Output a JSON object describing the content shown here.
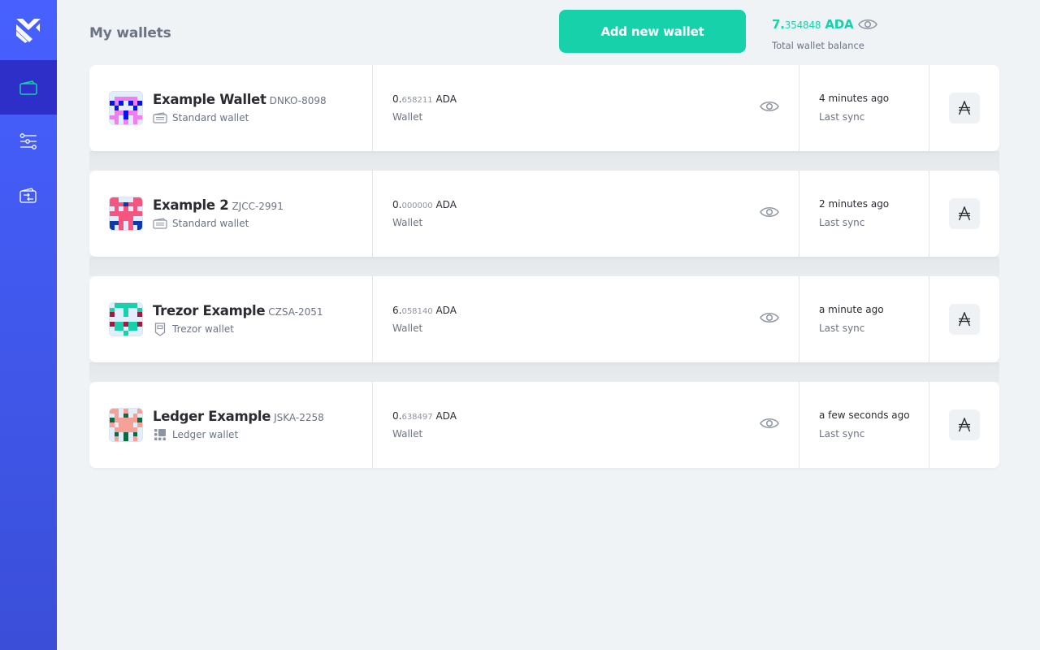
{
  "sidebar": {
    "items": [
      {
        "name": "wallets",
        "icon": "wallet-icon",
        "active": true
      },
      {
        "name": "settings",
        "icon": "sliders-icon",
        "active": false
      },
      {
        "name": "transfer",
        "icon": "transfer-icon",
        "active": false
      }
    ]
  },
  "header": {
    "title": "My wallets",
    "add_wallet_label": "Add new wallet",
    "total_balance": {
      "integer": "7.",
      "decimal": "354848",
      "currency": "ADA"
    },
    "total_balance_label": "Total wallet balance"
  },
  "colors": {
    "accent": "#17d1aa",
    "sidebar": "#4760ff",
    "sidebar_active": "#2e2fc8"
  },
  "wallets": [
    {
      "name": "Example Wallet",
      "plate": "DNKO-8098",
      "type": "Standard wallet",
      "type_icon": "standard-wallet-icon",
      "balance": {
        "integer": "0.",
        "decimal": "658211",
        "currency": "ADA"
      },
      "balance_label": "Wallet",
      "sync_time": "4 minutes ago",
      "sync_label": "Last sync",
      "identicon": {
        "colors": {
          "a": "#e2eefc",
          "b": "#f07ff0",
          "c": "#0612e8"
        },
        "grid": [
          "aaaaaaa",
          "abbbbba",
          "cbcacbc",
          "acaaaca",
          "abbcbba",
          "bbacabb",
          "abababa"
        ]
      }
    },
    {
      "name": "Example 2",
      "plate": "ZJCC-2991",
      "type": "Standard wallet",
      "type_icon": "standard-wallet-icon",
      "balance": {
        "integer": "0.",
        "decimal": "000000",
        "currency": "ADA"
      },
      "balance_label": "Wallet",
      "sync_time": "2 minutes ago",
      "sync_label": "Last sync",
      "identicon": {
        "colors": {
          "a": "#e2eefc",
          "b": "#f5557f",
          "c": "#0c3aab"
        },
        "grid": [
          "bbaaabb",
          "bbbcbbb",
          "abababa",
          "bbbbbbb",
          "aabbbaa",
          "ccbabcc",
          "cababac"
        ]
      }
    },
    {
      "name": "Trezor Example",
      "plate": "CZSA-2051",
      "type": "Trezor wallet",
      "type_icon": "trezor-icon",
      "balance": {
        "integer": "6.",
        "decimal": "058140",
        "currency": "ADA"
      },
      "balance_label": "Wallet",
      "sync_time": "a minute ago",
      "sync_label": "Last sync",
      "identicon": {
        "colors": {
          "a": "#e2eefc",
          "b": "#17d1aa",
          "c": "#a31a41"
        },
        "grid": [
          "abbbbba",
          "baabaab",
          "caabaac",
          "aaaaaaa",
          "cbbcbbc",
          "abbabba",
          "aaabaaa"
        ]
      }
    },
    {
      "name": "Ledger Example",
      "plate": "JSKA-2258",
      "type": "Ledger wallet",
      "type_icon": "ledger-icon",
      "balance": {
        "integer": "0.",
        "decimal": "638497",
        "currency": "ADA"
      },
      "balance_label": "Wallet",
      "sync_time": "a few seconds ago",
      "sync_label": "Last sync",
      "identicon": {
        "colors": {
          "a": "#e2eefc",
          "b": "#f5a198",
          "c": "#0c6a40"
        },
        "grid": [
          "bbabaab",
          "abacaba",
          "cbbbbbc",
          "babbbab",
          "abbbbba",
          "acacaca",
          "abacaba"
        ]
      }
    }
  ]
}
